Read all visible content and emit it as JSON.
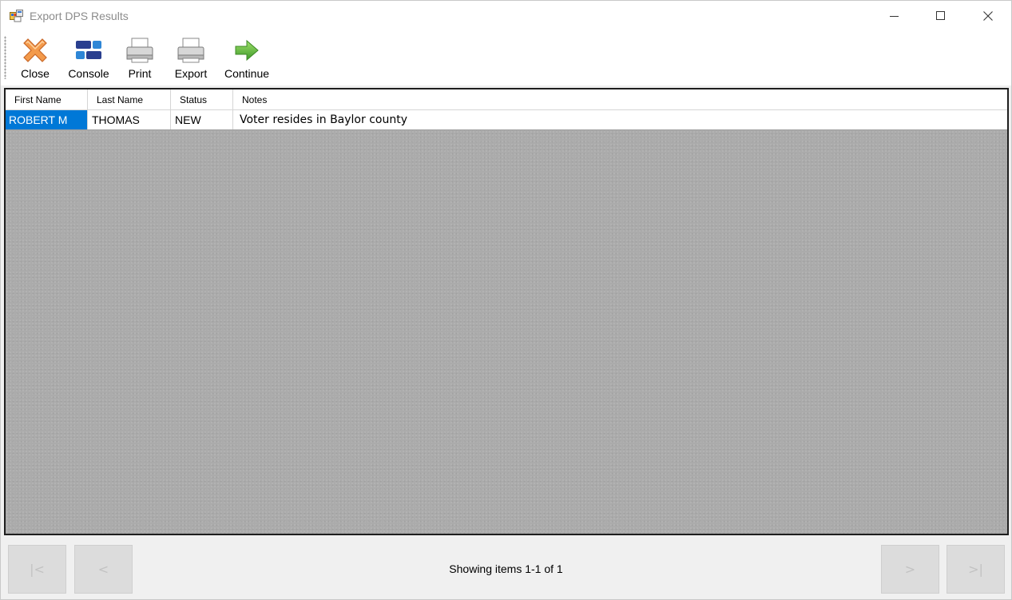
{
  "window": {
    "title": "Export DPS Results"
  },
  "toolbar": {
    "close_label": "Close",
    "console_label": "Console",
    "print_label": "Print",
    "export_label": "Export",
    "continue_label": "Continue"
  },
  "grid": {
    "columns": [
      "First Name",
      "Last Name",
      "Status",
      "Notes"
    ],
    "rows": [
      {
        "first_name": "ROBERT M",
        "last_name": "THOMAS",
        "status": "NEW",
        "notes": "Voter resides in Baylor county"
      }
    ]
  },
  "footer": {
    "first_label": "|<",
    "prev_label": "<",
    "next_label": ">",
    "last_label": ">|",
    "status_text": "Showing items 1-1 of 1"
  },
  "colors": {
    "selection": "#0078d7",
    "grid_background": "#ababab"
  }
}
